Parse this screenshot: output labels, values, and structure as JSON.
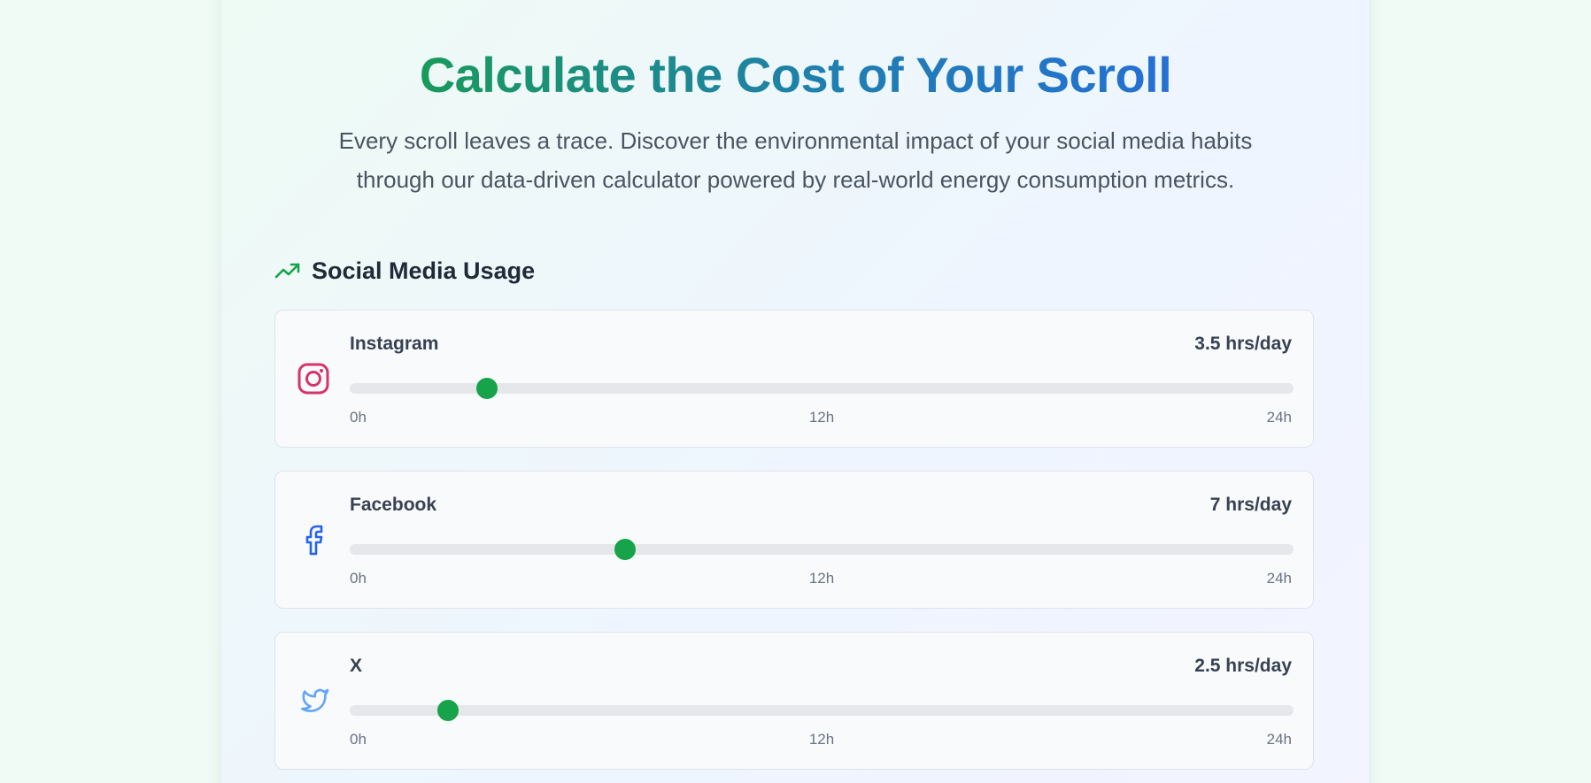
{
  "header": {
    "title": "Calculate the Cost of Your Scroll",
    "subtitle": "Every scroll leaves a trace. Discover the environmental impact of your social media habits through our data-driven calculator powered by real-world energy consumption metrics."
  },
  "usage_section": {
    "title": "Social Media Usage",
    "icon": "trending-up-icon",
    "slider_max_hours": 24,
    "apps": [
      {
        "name": "Instagram",
        "icon": "instagram-icon",
        "icon_color": "#d6336c",
        "hours_label": "3.5 hrs/day",
        "hours_value": 3.5,
        "tick_min": "0h",
        "tick_mid": "12h",
        "tick_max": "24h"
      },
      {
        "name": "Facebook",
        "icon": "facebook-icon",
        "icon_color": "#2563eb",
        "hours_label": "7 hrs/day",
        "hours_value": 7,
        "tick_min": "0h",
        "tick_mid": "12h",
        "tick_max": "24h"
      },
      {
        "name": "X",
        "icon": "twitter-bird-icon",
        "icon_color": "#60a5fa",
        "hours_label": "2.5 hrs/day",
        "hours_value": 2.5,
        "tick_min": "0h",
        "tick_mid": "12h",
        "tick_max": "24h"
      }
    ]
  },
  "colors": {
    "accent": "#16a34a",
    "title_gradient_start": "#199a5c",
    "title_gradient_end": "#2470d4",
    "track": "#e5e7eb"
  }
}
